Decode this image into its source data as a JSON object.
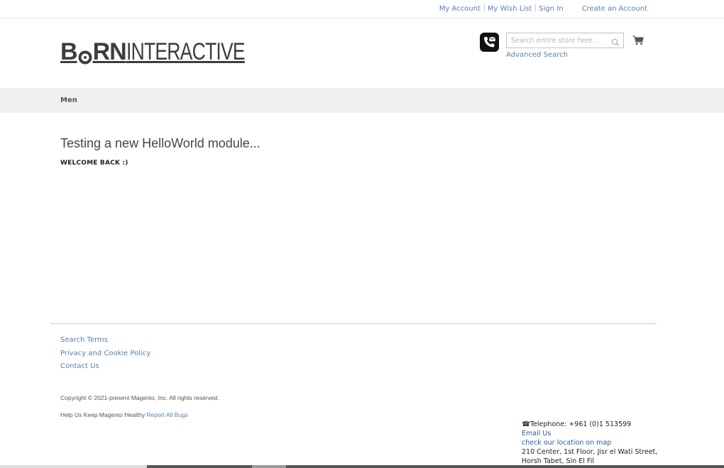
{
  "top_links": {
    "my_account": "My Account",
    "my_wish_list": "My Wish List",
    "sign_in": "Sign In",
    "create_account": "Create an Account"
  },
  "logo": {
    "part1": "B",
    "part2": "RN",
    "part3": "INTERACTIVE"
  },
  "search": {
    "placeholder": "Search entire store here...",
    "advanced": "Advanced Search"
  },
  "nav": {
    "items": [
      {
        "label": "Men"
      }
    ]
  },
  "main": {
    "title": "Testing a new HelloWorld module...",
    "welcome": "WELCOME BACK :)"
  },
  "footer": {
    "links": [
      "Search Terms",
      "Privacy and Cookie Policy",
      "Contact Us"
    ],
    "copyright": "Copyright © 2021-present Magento, Inc. All rights reserved.",
    "help_text": "Help Us Keep Magento Healthy",
    "report_bugs": "Report All Bugs",
    "contact": {
      "telephone": "Telephone: +961 (0)1 513599",
      "email": "Email Us",
      "map": "check our location on map",
      "address_line1": "210 Center, 1st Floor, Jisr el Wati Street,",
      "address_line2": "Horsh Tabet, Sin El Fil"
    }
  },
  "colors": {
    "link": "#5a7fb0",
    "nav_bg": "#f0f0f0",
    "logo": "#3d3d3d"
  },
  "icons": [
    "phone-mail-icon",
    "search-icon",
    "cart-icon",
    "telephone-icon"
  ]
}
